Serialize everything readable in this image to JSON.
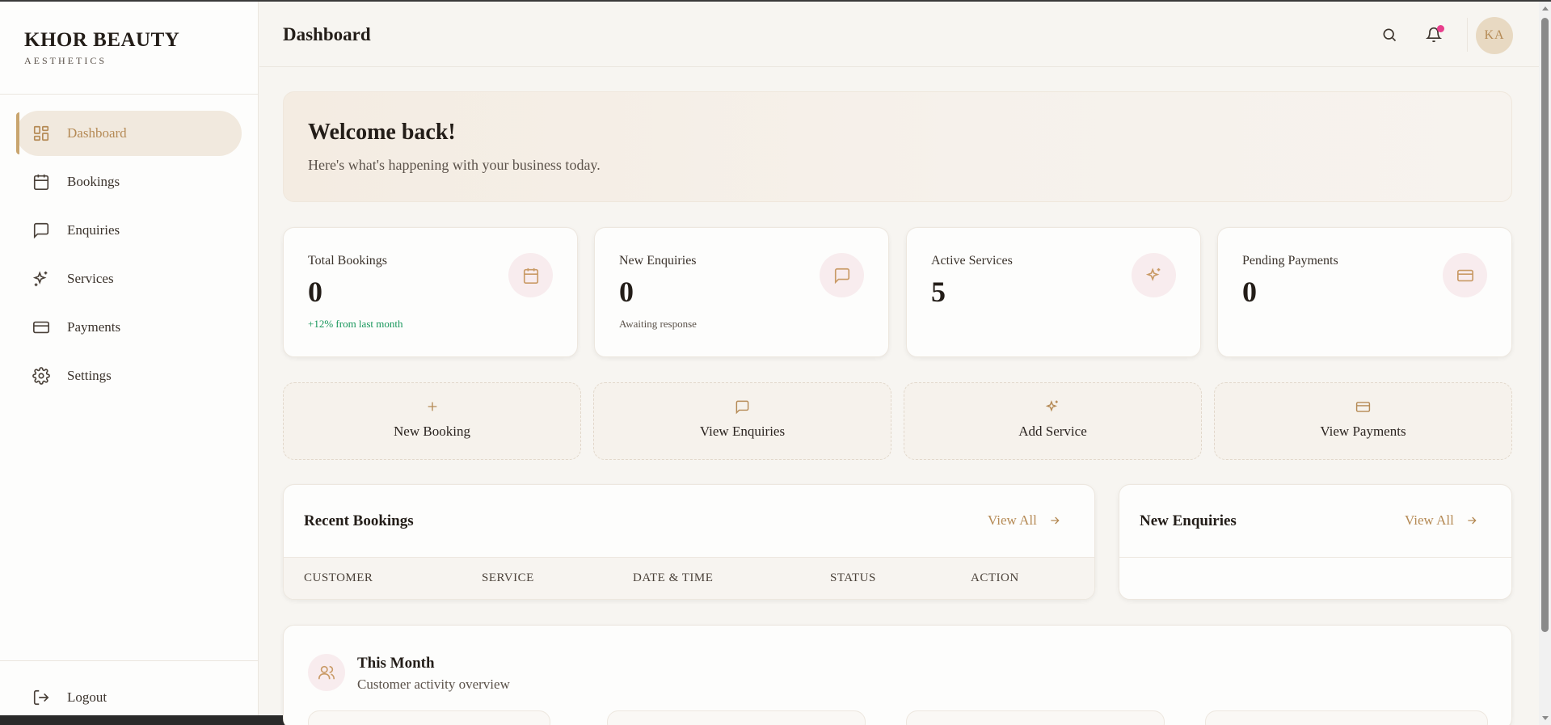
{
  "brand": {
    "name": "KHOR BEAUTY",
    "tagline": "AESTHETICS"
  },
  "sidebar": {
    "items": [
      {
        "label": "Dashboard",
        "icon": "dashboard-grid-icon",
        "active": true
      },
      {
        "label": "Bookings",
        "icon": "calendar-icon"
      },
      {
        "label": "Enquiries",
        "icon": "message-icon"
      },
      {
        "label": "Services",
        "icon": "sparkles-icon"
      },
      {
        "label": "Payments",
        "icon": "credit-card-icon"
      },
      {
        "label": "Settings",
        "icon": "gear-icon"
      }
    ],
    "logout_label": "Logout"
  },
  "header": {
    "title": "Dashboard",
    "avatar_initials": "KA"
  },
  "welcome": {
    "title": "Welcome back!",
    "subtitle": "Here's what's happening with your business today."
  },
  "stats": [
    {
      "label": "Total Bookings",
      "value": "0",
      "sub": "+12% from last month",
      "icon": "calendar-icon"
    },
    {
      "label": "New Enquiries",
      "value": "0",
      "sub": "Awaiting response",
      "icon": "message-icon"
    },
    {
      "label": "Active Services",
      "value": "5",
      "sub": "",
      "icon": "sparkles-icon"
    },
    {
      "label": "Pending Payments",
      "value": "0",
      "sub": "",
      "icon": "credit-card-icon"
    }
  ],
  "quick_actions": [
    {
      "label": "New Booking",
      "icon": "plus-icon"
    },
    {
      "label": "View Enquiries",
      "icon": "message-icon"
    },
    {
      "label": "Add Service",
      "icon": "sparkles-icon"
    },
    {
      "label": "View Payments",
      "icon": "credit-card-icon"
    }
  ],
  "recent_bookings": {
    "title": "Recent Bookings",
    "view_all": "View All",
    "columns": [
      "CUSTOMER",
      "SERVICE",
      "DATE & TIME",
      "STATUS",
      "ACTION"
    ]
  },
  "new_enquiries": {
    "title": "New Enquiries",
    "view_all": "View All"
  },
  "this_month": {
    "title": "This Month",
    "subtitle": "Customer activity overview"
  },
  "colors": {
    "accent": "#b58a55",
    "accent_bg": "#f1e9de",
    "icon_bubble": "#f8ecee",
    "positive": "#16965a",
    "notification": "#e83e8c"
  }
}
